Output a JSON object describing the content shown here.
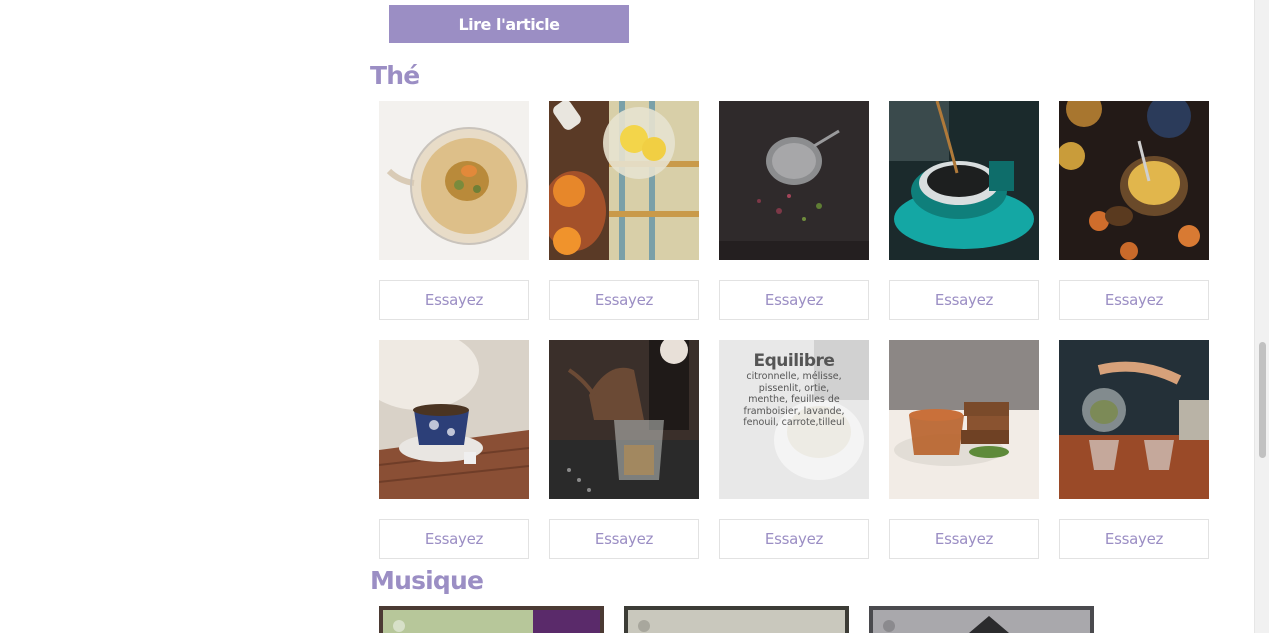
{
  "read_button_label": "Lire l'article",
  "sections": {
    "tea": {
      "title": "Thé"
    },
    "music": {
      "title": "Musique"
    }
  },
  "try_label": "Essayez",
  "tea_tiles": [
    {
      "icon": "flower-tea-teapot-photo"
    },
    {
      "icon": "lemon-tea-honey-photo"
    },
    {
      "icon": "tea-strainer-photo"
    },
    {
      "icon": "teal-cup-pouring-photo"
    },
    {
      "icon": "tea-table-spread-photo"
    },
    {
      "icon": "blue-teacup-photo"
    },
    {
      "icon": "kettle-tea-glass-photo"
    },
    {
      "icon": "equilibre-blend-photo"
    },
    {
      "icon": "tea-cake-photo"
    },
    {
      "icon": "glass-teapot-pouring-photo"
    }
  ],
  "equilibre": {
    "title": "Equilibre",
    "ingredients": "citronnelle, mélisse, pissenlit, ortie, menthe, feuilles de framboisier, lavande, fenouil, carrote,tilleul"
  },
  "colors": {
    "accent": "#9b8ec4",
    "button_border": "#e2e2e2"
  }
}
